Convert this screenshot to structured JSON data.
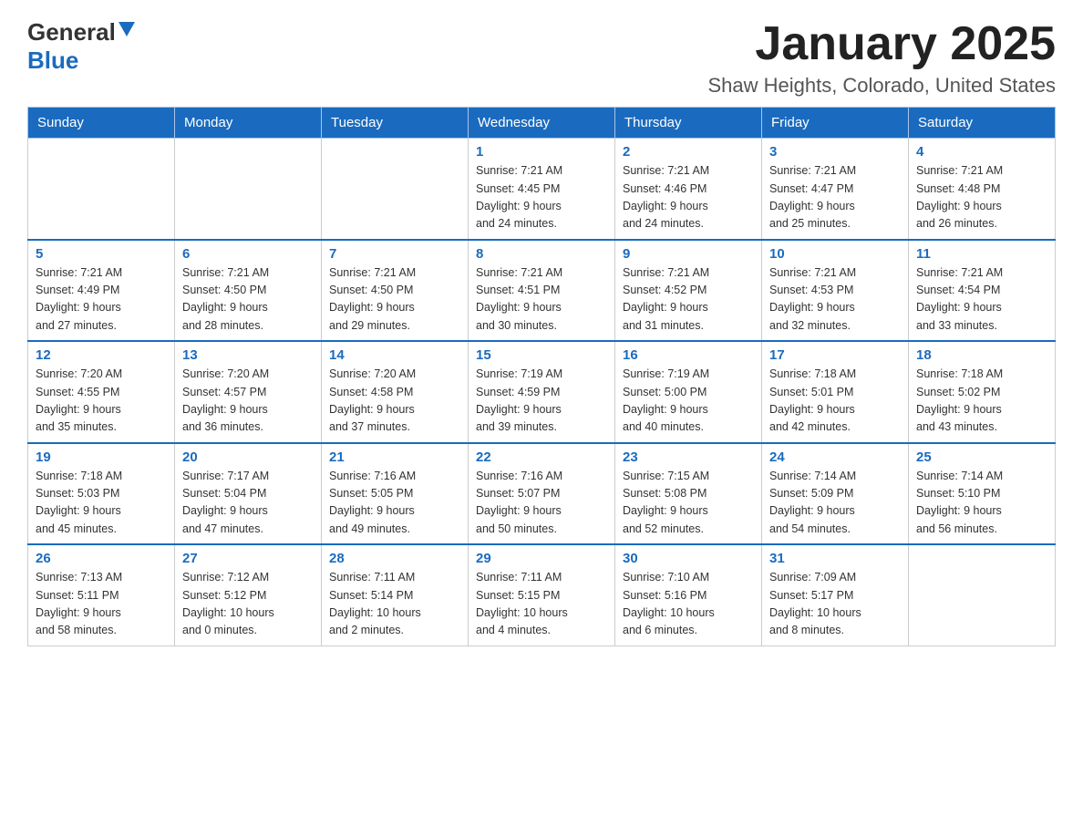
{
  "logo": {
    "general": "General",
    "blue": "Blue"
  },
  "title": {
    "month": "January 2025",
    "location": "Shaw Heights, Colorado, United States"
  },
  "weekdays": [
    "Sunday",
    "Monday",
    "Tuesday",
    "Wednesday",
    "Thursday",
    "Friday",
    "Saturday"
  ],
  "weeks": [
    [
      {
        "day": "",
        "info": ""
      },
      {
        "day": "",
        "info": ""
      },
      {
        "day": "",
        "info": ""
      },
      {
        "day": "1",
        "info": "Sunrise: 7:21 AM\nSunset: 4:45 PM\nDaylight: 9 hours\nand 24 minutes."
      },
      {
        "day": "2",
        "info": "Sunrise: 7:21 AM\nSunset: 4:46 PM\nDaylight: 9 hours\nand 24 minutes."
      },
      {
        "day": "3",
        "info": "Sunrise: 7:21 AM\nSunset: 4:47 PM\nDaylight: 9 hours\nand 25 minutes."
      },
      {
        "day": "4",
        "info": "Sunrise: 7:21 AM\nSunset: 4:48 PM\nDaylight: 9 hours\nand 26 minutes."
      }
    ],
    [
      {
        "day": "5",
        "info": "Sunrise: 7:21 AM\nSunset: 4:49 PM\nDaylight: 9 hours\nand 27 minutes."
      },
      {
        "day": "6",
        "info": "Sunrise: 7:21 AM\nSunset: 4:50 PM\nDaylight: 9 hours\nand 28 minutes."
      },
      {
        "day": "7",
        "info": "Sunrise: 7:21 AM\nSunset: 4:50 PM\nDaylight: 9 hours\nand 29 minutes."
      },
      {
        "day": "8",
        "info": "Sunrise: 7:21 AM\nSunset: 4:51 PM\nDaylight: 9 hours\nand 30 minutes."
      },
      {
        "day": "9",
        "info": "Sunrise: 7:21 AM\nSunset: 4:52 PM\nDaylight: 9 hours\nand 31 minutes."
      },
      {
        "day": "10",
        "info": "Sunrise: 7:21 AM\nSunset: 4:53 PM\nDaylight: 9 hours\nand 32 minutes."
      },
      {
        "day": "11",
        "info": "Sunrise: 7:21 AM\nSunset: 4:54 PM\nDaylight: 9 hours\nand 33 minutes."
      }
    ],
    [
      {
        "day": "12",
        "info": "Sunrise: 7:20 AM\nSunset: 4:55 PM\nDaylight: 9 hours\nand 35 minutes."
      },
      {
        "day": "13",
        "info": "Sunrise: 7:20 AM\nSunset: 4:57 PM\nDaylight: 9 hours\nand 36 minutes."
      },
      {
        "day": "14",
        "info": "Sunrise: 7:20 AM\nSunset: 4:58 PM\nDaylight: 9 hours\nand 37 minutes."
      },
      {
        "day": "15",
        "info": "Sunrise: 7:19 AM\nSunset: 4:59 PM\nDaylight: 9 hours\nand 39 minutes."
      },
      {
        "day": "16",
        "info": "Sunrise: 7:19 AM\nSunset: 5:00 PM\nDaylight: 9 hours\nand 40 minutes."
      },
      {
        "day": "17",
        "info": "Sunrise: 7:18 AM\nSunset: 5:01 PM\nDaylight: 9 hours\nand 42 minutes."
      },
      {
        "day": "18",
        "info": "Sunrise: 7:18 AM\nSunset: 5:02 PM\nDaylight: 9 hours\nand 43 minutes."
      }
    ],
    [
      {
        "day": "19",
        "info": "Sunrise: 7:18 AM\nSunset: 5:03 PM\nDaylight: 9 hours\nand 45 minutes."
      },
      {
        "day": "20",
        "info": "Sunrise: 7:17 AM\nSunset: 5:04 PM\nDaylight: 9 hours\nand 47 minutes."
      },
      {
        "day": "21",
        "info": "Sunrise: 7:16 AM\nSunset: 5:05 PM\nDaylight: 9 hours\nand 49 minutes."
      },
      {
        "day": "22",
        "info": "Sunrise: 7:16 AM\nSunset: 5:07 PM\nDaylight: 9 hours\nand 50 minutes."
      },
      {
        "day": "23",
        "info": "Sunrise: 7:15 AM\nSunset: 5:08 PM\nDaylight: 9 hours\nand 52 minutes."
      },
      {
        "day": "24",
        "info": "Sunrise: 7:14 AM\nSunset: 5:09 PM\nDaylight: 9 hours\nand 54 minutes."
      },
      {
        "day": "25",
        "info": "Sunrise: 7:14 AM\nSunset: 5:10 PM\nDaylight: 9 hours\nand 56 minutes."
      }
    ],
    [
      {
        "day": "26",
        "info": "Sunrise: 7:13 AM\nSunset: 5:11 PM\nDaylight: 9 hours\nand 58 minutes."
      },
      {
        "day": "27",
        "info": "Sunrise: 7:12 AM\nSunset: 5:12 PM\nDaylight: 10 hours\nand 0 minutes."
      },
      {
        "day": "28",
        "info": "Sunrise: 7:11 AM\nSunset: 5:14 PM\nDaylight: 10 hours\nand 2 minutes."
      },
      {
        "day": "29",
        "info": "Sunrise: 7:11 AM\nSunset: 5:15 PM\nDaylight: 10 hours\nand 4 minutes."
      },
      {
        "day": "30",
        "info": "Sunrise: 7:10 AM\nSunset: 5:16 PM\nDaylight: 10 hours\nand 6 minutes."
      },
      {
        "day": "31",
        "info": "Sunrise: 7:09 AM\nSunset: 5:17 PM\nDaylight: 10 hours\nand 8 minutes."
      },
      {
        "day": "",
        "info": ""
      }
    ]
  ]
}
